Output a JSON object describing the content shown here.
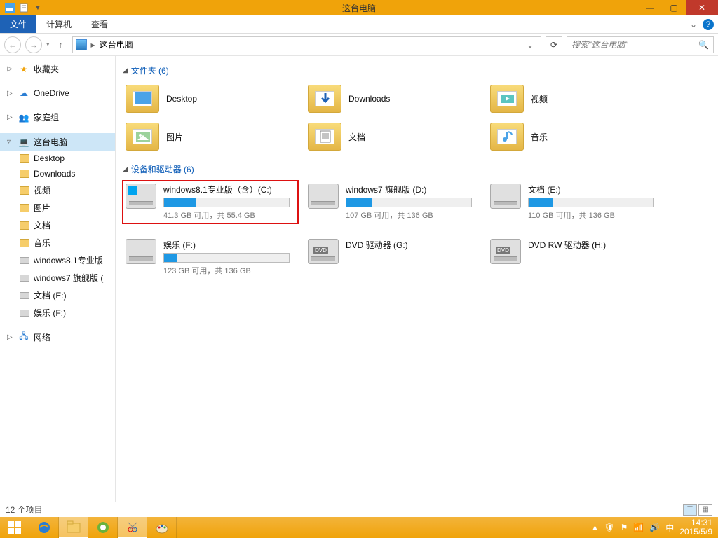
{
  "title": "这台电脑",
  "ribbon": {
    "file": "文件",
    "tabs": [
      "计算机",
      "查看"
    ]
  },
  "address": {
    "location": "这台电脑"
  },
  "search": {
    "placeholder": "搜索\"这台电脑\""
  },
  "sidebar": {
    "favorites": "收藏夹",
    "onedrive": "OneDrive",
    "homegroup": "家庭组",
    "thispc": "这台电脑",
    "pcitems": [
      "Desktop",
      "Downloads",
      "视频",
      "图片",
      "文档",
      "音乐",
      "windows8.1专业版",
      "windows7 旗舰版 (",
      "文档 (E:)",
      "娱乐 (F:)"
    ],
    "network": "网络"
  },
  "groups": {
    "folders_header": "文件夹 (6)",
    "drives_header": "设备和驱动器 (6)"
  },
  "folders": [
    {
      "label": "Desktop",
      "kind": "desktop"
    },
    {
      "label": "Downloads",
      "kind": "downloads"
    },
    {
      "label": "视频",
      "kind": "video"
    },
    {
      "label": "图片",
      "kind": "pictures"
    },
    {
      "label": "文档",
      "kind": "docs"
    },
    {
      "label": "音乐",
      "kind": "music"
    }
  ],
  "drives": [
    {
      "name": "windows8.1专业版（含）(C:)",
      "stat": "41.3 GB 可用，共 55.4 GB",
      "fill": 26,
      "os": true,
      "highlight": true
    },
    {
      "name": "windows7 旗舰版 (D:)",
      "stat": "107 GB 可用，共 136 GB",
      "fill": 21,
      "os": false
    },
    {
      "name": "文档 (E:)",
      "stat": "110 GB 可用，共 136 GB",
      "fill": 19,
      "os": false
    },
    {
      "name": "娱乐 (F:)",
      "stat": "123 GB 可用，共 136 GB",
      "fill": 10,
      "os": false
    },
    {
      "name": "DVD 驱动器 (G:)",
      "dvd": true
    },
    {
      "name": "DVD RW 驱动器 (H:)",
      "dvd": true
    }
  ],
  "status": {
    "count": "12 个项目"
  },
  "tray": {
    "time": "14:31",
    "date": "2015/5/9"
  }
}
